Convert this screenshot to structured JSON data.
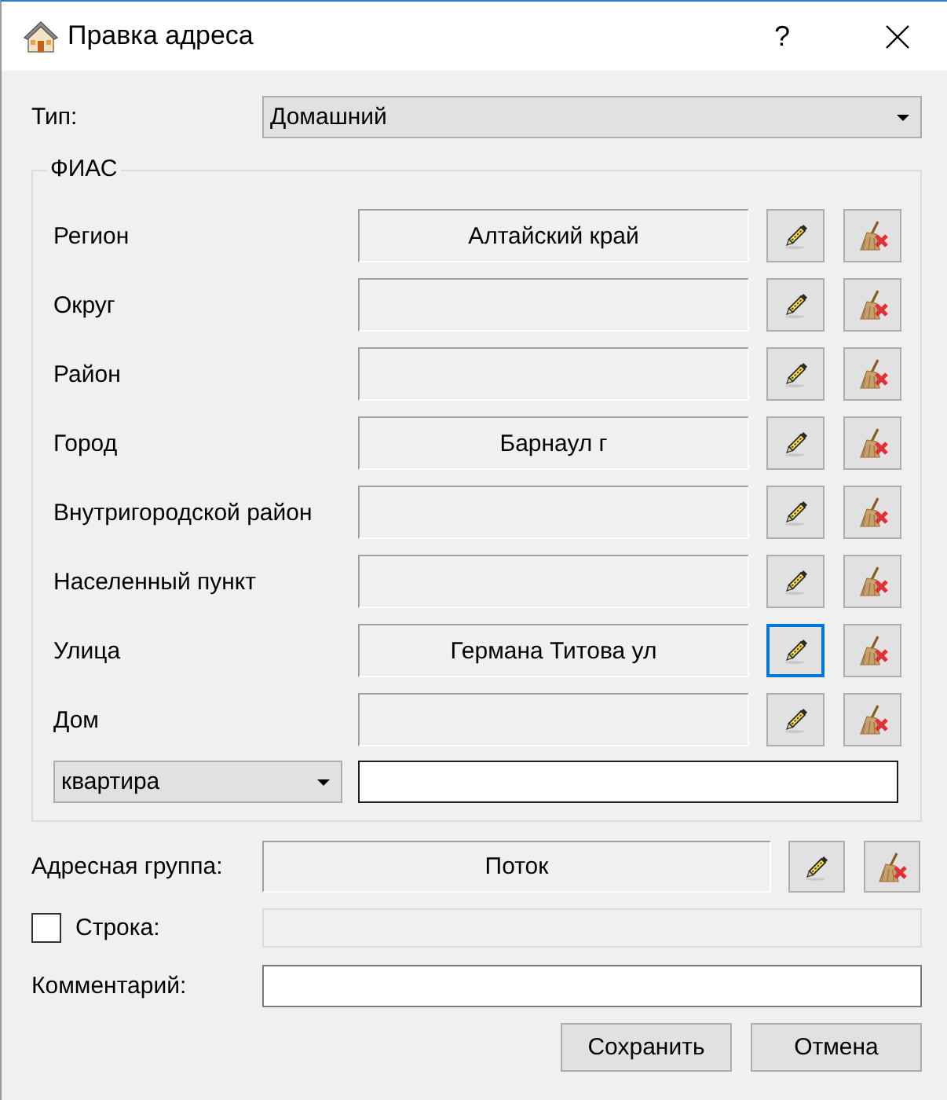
{
  "window": {
    "title": "Правка адреса",
    "help": "?"
  },
  "type_field": {
    "label": "Тип:",
    "value": "Домашний"
  },
  "fias": {
    "title": "ФИАС",
    "rows": [
      {
        "label": "Регион",
        "value": "Алтайский край",
        "edit_focused": false
      },
      {
        "label": "Округ",
        "edit_focused": false
      },
      {
        "label": "Район",
        "edit_focused": false
      },
      {
        "label": "Город",
        "value": "Барнаул г",
        "edit_focused": false
      },
      {
        "label": "Внутригородской район",
        "edit_focused": false
      },
      {
        "label": "Населенный пункт",
        "edit_focused": false
      },
      {
        "label": "Улица",
        "value": "Германа Титова ул",
        "edit_focused": true
      },
      {
        "label": "Дом",
        "edit_focused": false
      }
    ],
    "unit": {
      "value": "квартира"
    }
  },
  "address_group": {
    "label": "Адресная группа:",
    "value": "Поток"
  },
  "line": {
    "label": "Строка:",
    "checked": false
  },
  "comment": {
    "label": "Комментарий:"
  },
  "buttons": [
    {
      "label": "Сохранить"
    },
    {
      "label": "Отмена"
    }
  ]
}
